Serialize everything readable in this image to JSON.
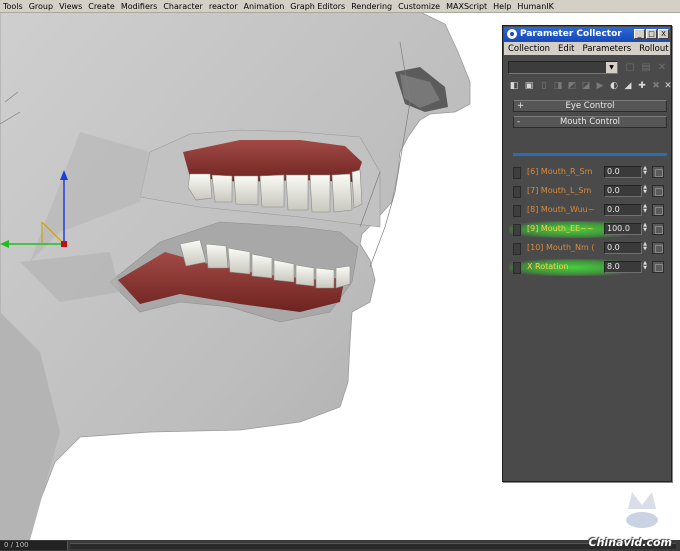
{
  "menubar": {
    "items": [
      "Tools",
      "Group",
      "Views",
      "Create",
      "Modifiers",
      "Character",
      "reactor",
      "Animation",
      "Graph Editors",
      "Rendering",
      "Customize",
      "MAXScript",
      "Help",
      "HumanIK"
    ]
  },
  "dialog": {
    "title": "Parameter Collector",
    "window_buttons": [
      "_",
      "□",
      "X"
    ],
    "menu": [
      "Collection",
      "Edit",
      "Parameters",
      "Rollout"
    ],
    "rollouts": [
      {
        "sign": "+",
        "label": "Eye Control"
      },
      {
        "sign": "-",
        "label": "Mouth Control"
      }
    ],
    "params": [
      {
        "label": "[6] Mouth_R_Sm",
        "value": "0.0",
        "highlight": false
      },
      {
        "label": "[7] Mouth_L_Sm",
        "value": "0.0",
        "highlight": false
      },
      {
        "label": "[8] Mouth_Wuu~",
        "value": "0.0",
        "highlight": false
      },
      {
        "label": "[9] Mouth_EE~~",
        "value": "100.0",
        "highlight": true
      },
      {
        "label": "[10] Mouth_Nm (",
        "value": "0.0",
        "highlight": false
      },
      {
        "label": "X Rotation",
        "value": "8.0",
        "highlight": true
      }
    ],
    "highlight_color": "#46e63c",
    "label_color": "#d98b3e"
  },
  "timebar": {
    "frame_text": "0 / 100"
  },
  "watermark": {
    "text": "Chinavid.com"
  },
  "viewport": {
    "icons": [
      "transform-gizmo-icon",
      "head-mesh-illustration"
    ]
  }
}
